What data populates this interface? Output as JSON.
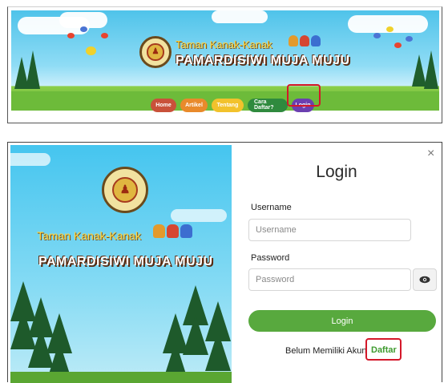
{
  "school": {
    "name_small": "Taman Kanak-Kanak",
    "name_big": "PAMARDISIWI MUJA MUJU"
  },
  "nav": {
    "items": [
      {
        "label": "Home",
        "color": "#c9513a"
      },
      {
        "label": "Artikel",
        "color": "#e98a2b"
      },
      {
        "label": "Tentang",
        "color": "#f2c22c"
      },
      {
        "label": "Cara Daftar?",
        "color": "#2f8a3e"
      },
      {
        "label": "Login",
        "color": "#6b3fb0"
      }
    ]
  },
  "login": {
    "title": "Login",
    "close_icon": "×",
    "username_label": "Username",
    "username_placeholder": "Username",
    "password_label": "Password",
    "password_placeholder": "Password",
    "submit_label": "Login",
    "no_account_text": "Belum Memiliki Akun",
    "register_link": "Daftar"
  },
  "colors": {
    "highlight": "#d4182a",
    "primary_green": "#58a93e"
  }
}
